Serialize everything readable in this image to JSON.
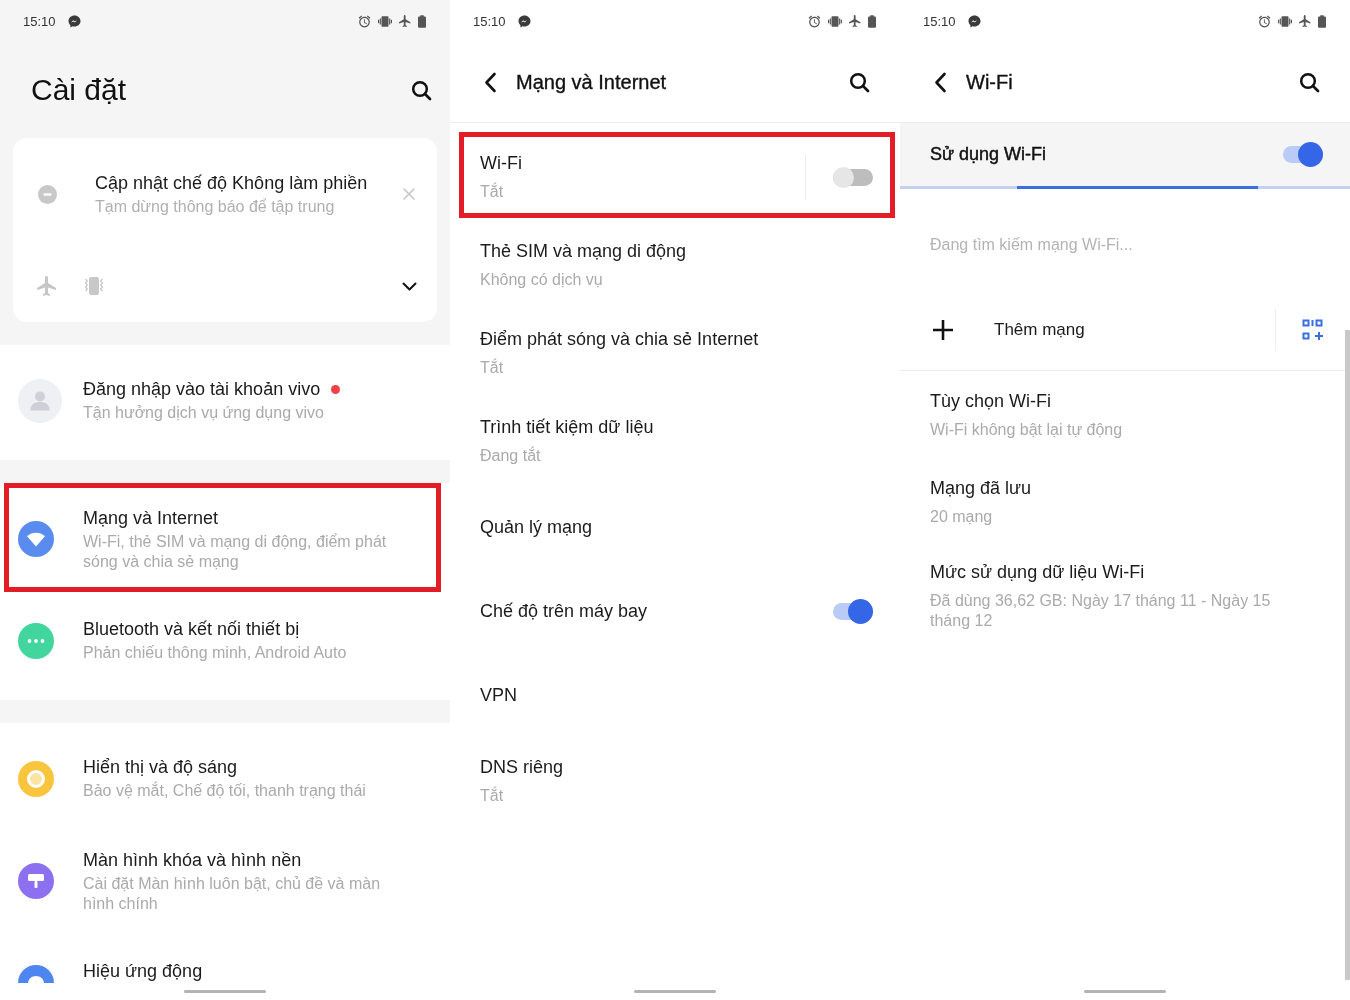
{
  "screens": [
    {
      "kind": "home",
      "status_bar": {
        "time": "15:10"
      },
      "title": "Cài đặt",
      "suggestion": {
        "title": "Cập nhật chế độ Không làm phiền",
        "subtitle": "Tạm dừng thông báo để tập trung"
      },
      "groups": [
        {
          "items": [
            {
              "title": "Đăng nhập vào tài khoản vivo",
              "subtitle": "Tận hưởng dịch vụ ứng dụng vivo",
              "color": "#eef0f3",
              "notification_dot": true,
              "highlighted": false
            }
          ]
        },
        {
          "items": [
            {
              "title": "Mạng và Internet",
              "subtitle": "Wi-Fi, thẻ SIM và mạng di động, điểm phát sóng và chia sẻ mạng",
              "color": "#5a8cf0",
              "notification_dot": false,
              "highlighted": true
            },
            {
              "title": "Bluetooth và kết nối thiết bị",
              "subtitle": "Phản chiếu thông minh, Android Auto",
              "color": "#42d59d",
              "notification_dot": false,
              "highlighted": false
            }
          ]
        },
        {
          "items": [
            {
              "title": "Hiển thị và độ sáng",
              "subtitle": "Bảo vệ mắt, Chế độ tối, thanh trạng thái",
              "color": "#f9c53d",
              "notification_dot": false,
              "highlighted": false
            },
            {
              "title": "Màn hình khóa và hình nền",
              "subtitle": "Cài đặt Màn hình luôn bật, chủ đề và màn hình chính",
              "color": "#8c70f0",
              "notification_dot": false,
              "highlighted": false
            },
            {
              "title": "Hiệu ứng động",
              "color": "#4d86f0",
              "notification_dot": false,
              "highlighted": false
            }
          ]
        }
      ]
    },
    {
      "kind": "submenu",
      "status_bar": {
        "time": "15:10"
      },
      "title": "Mạng và Internet",
      "items": [
        {
          "kind": "split_switch",
          "title": "Wi-Fi",
          "subtitle": "Tắt",
          "on": false,
          "highlighted": true
        },
        {
          "kind": "link",
          "title": "Thẻ SIM và mạng di động",
          "subtitle": "Không có dịch vụ",
          "highlighted": false
        },
        {
          "kind": "link",
          "title": "Điểm phát sóng và chia sẻ Internet",
          "subtitle": "Tắt",
          "highlighted": false
        },
        {
          "kind": "link",
          "title": "Trình tiết kiệm dữ liệu",
          "subtitle": "Đang tắt",
          "highlighted": false
        },
        {
          "kind": "link",
          "title": "Quản lý mạng",
          "highlighted": false
        },
        {
          "kind": "switch",
          "title": "Chế độ trên máy bay",
          "on": true,
          "highlighted": false
        },
        {
          "kind": "link",
          "title": "VPN",
          "highlighted": false
        },
        {
          "kind": "link",
          "title": "DNS riêng",
          "subtitle": "Tắt",
          "highlighted": false
        }
      ]
    },
    {
      "kind": "wifi",
      "status_bar": {
        "time": "15:10"
      },
      "title": "Wi-Fi",
      "master_switch": {
        "label": "Sử dụng Wi-Fi",
        "on": true
      },
      "scanning": true,
      "scan_status": "Đang tìm kiếm mạng Wi-Fi...",
      "add_network": "Thêm mạng",
      "items": [
        {
          "kind": "link",
          "title": "Tùy chọn Wi-Fi",
          "subtitle": "Wi-Fi không bật lại tự động"
        },
        {
          "kind": "link",
          "title": "Mạng đã lưu",
          "subtitle": "20 mạng"
        },
        {
          "kind": "link",
          "title": "Mức sử dụng dữ liệu Wi-Fi",
          "subtitle": "Đã dùng 36,62 GB: Ngày 17 tháng 11 - Ngày 15 tháng 12"
        }
      ]
    }
  ]
}
